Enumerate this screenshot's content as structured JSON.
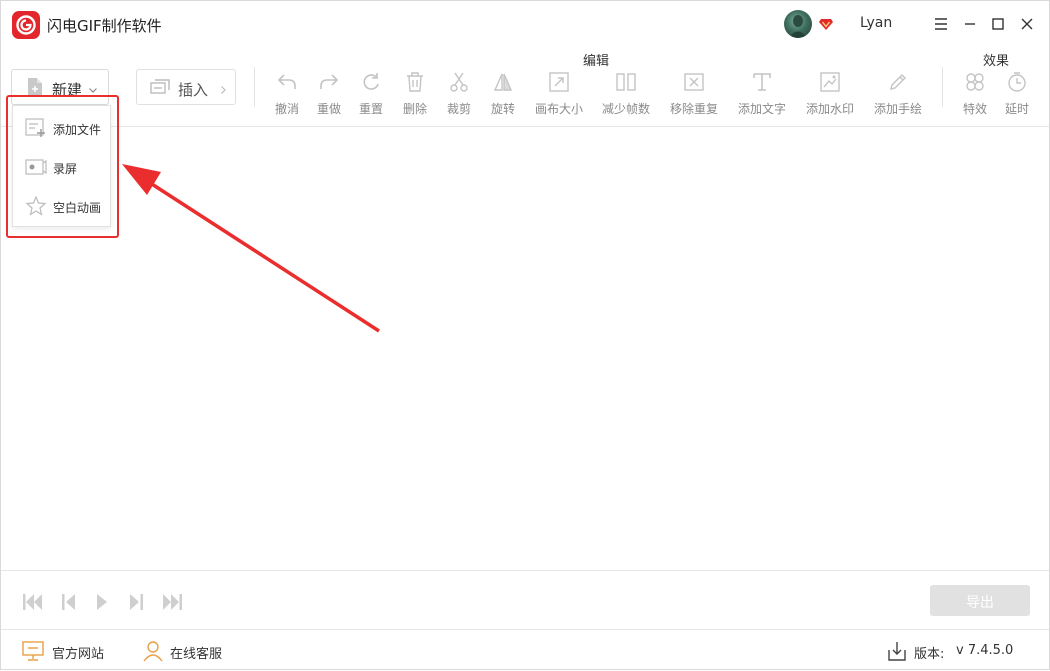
{
  "app": {
    "title": "闪电GIF制作软件",
    "username": "Lyan",
    "brand_color": "#e3262c"
  },
  "toolbar": {
    "new_label": "新建",
    "insert_label": "插入",
    "edit_group_title": "编辑",
    "effects_group_title": "效果",
    "edit_tools": [
      {
        "label": "撤消",
        "icon": "undo-icon"
      },
      {
        "label": "重做",
        "icon": "redo-icon"
      },
      {
        "label": "重置",
        "icon": "reset-icon"
      },
      {
        "label": "删除",
        "icon": "delete-icon"
      },
      {
        "label": "裁剪",
        "icon": "scissors-icon"
      },
      {
        "label": "旋转",
        "icon": "rotate-icon"
      },
      {
        "label": "画布大小",
        "icon": "canvas-size-icon"
      },
      {
        "label": "减少帧数",
        "icon": "reduce-frames-icon"
      },
      {
        "label": "移除重复",
        "icon": "remove-duplicate-icon"
      },
      {
        "label": "添加文字",
        "icon": "text-icon"
      },
      {
        "label": "添加水印",
        "icon": "watermark-icon"
      },
      {
        "label": "添加手绘",
        "icon": "pen-icon"
      }
    ],
    "effect_tools": [
      {
        "label": "特效",
        "icon": "effects-icon"
      },
      {
        "label": "延时",
        "icon": "timer-icon"
      }
    ]
  },
  "new_menu": {
    "items": [
      {
        "label": "添加文件",
        "icon": "add-file-icon"
      },
      {
        "label": "录屏",
        "icon": "record-screen-icon"
      },
      {
        "label": "空白动画",
        "icon": "blank-animation-icon"
      }
    ]
  },
  "playback": {
    "export_label": "导出"
  },
  "status": {
    "website_label": "官方网站",
    "support_label": "在线客服",
    "version_label": "版本:",
    "version_value": "v 7.4.5.0"
  },
  "colors": {
    "annotation_red": "#ea2e2e",
    "icon_gray": "#c4c4c4",
    "link_accent": "#e8a04a"
  }
}
